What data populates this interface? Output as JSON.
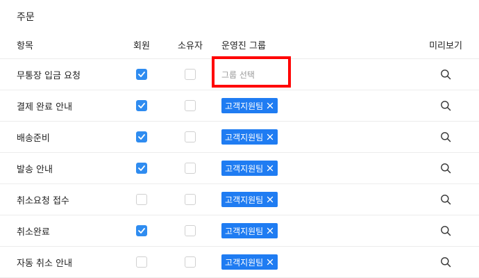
{
  "section": {
    "title": "주문"
  },
  "columns": {
    "item": "항목",
    "member": "회원",
    "owner": "소유자",
    "group": "운영진 그룹",
    "preview": "미리보기"
  },
  "group_placeholder": "그룹 선택",
  "rows": [
    {
      "label": "무통장 입금 요청",
      "member": true,
      "owner": false,
      "group": null
    },
    {
      "label": "결제 완료 안내",
      "member": true,
      "owner": false,
      "group": "고객지원팀"
    },
    {
      "label": "배송준비",
      "member": true,
      "owner": false,
      "group": "고객지원팀"
    },
    {
      "label": "발송 안내",
      "member": true,
      "owner": false,
      "group": "고객지원팀"
    },
    {
      "label": "취소요청 접수",
      "member": false,
      "owner": false,
      "group": "고객지원팀"
    },
    {
      "label": "취소완료",
      "member": true,
      "owner": false,
      "group": "고객지원팀"
    },
    {
      "label": "자동 취소 안내",
      "member": false,
      "owner": false,
      "group": "고객지원팀"
    }
  ],
  "colors": {
    "checkbox_checked": "#2f8cf0",
    "tag_bg": "#1f7cf2",
    "highlight": "#ff0000"
  },
  "icons": {
    "preview": "search-icon",
    "tag_remove": "close-icon",
    "check": "check-icon"
  }
}
